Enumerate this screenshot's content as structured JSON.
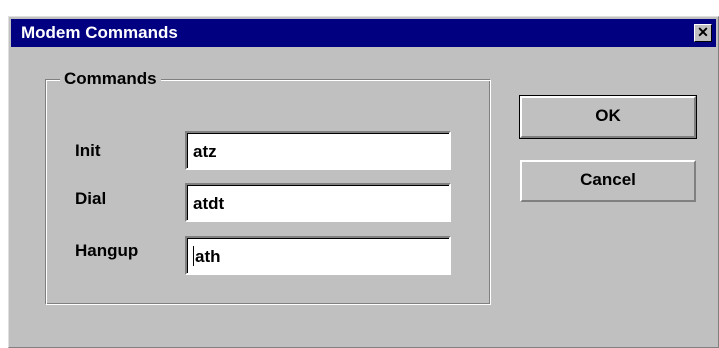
{
  "window": {
    "title": "Modem Commands",
    "close_label": "✕"
  },
  "group": {
    "label": "Commands"
  },
  "fields": [
    {
      "label": "Init",
      "value": "atz"
    },
    {
      "label": "Dial",
      "value": "atdt"
    },
    {
      "label": "Hangup",
      "value": "ath"
    }
  ],
  "buttons": {
    "ok": "OK",
    "cancel": "Cancel"
  }
}
